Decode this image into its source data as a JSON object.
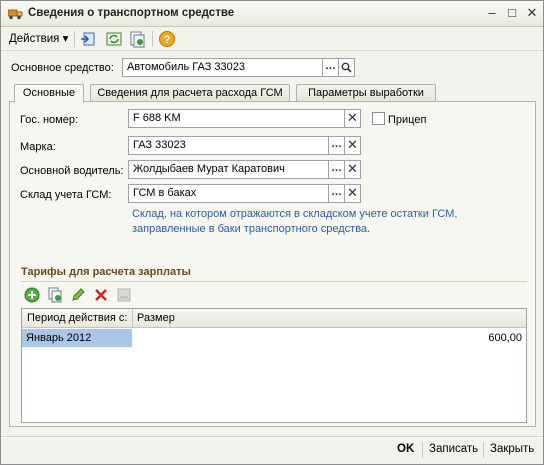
{
  "window": {
    "title": "Сведения о транспортном средстве"
  },
  "toolbar": {
    "actions_label": "Действия"
  },
  "main_asset": {
    "label": "Основное средство:",
    "value": "Автомобиль ГАЗ 33023"
  },
  "tabs": [
    {
      "label": "Основные"
    },
    {
      "label": "Сведения для расчета расхода ГСМ"
    },
    {
      "label": "Параметры выработки"
    }
  ],
  "fields": {
    "gos_nomer": {
      "label": "Гос. номер:",
      "value": "F 688 KM"
    },
    "marka": {
      "label": "Марка:",
      "value": "ГАЗ 33023"
    },
    "driver": {
      "label": "Основной водитель:",
      "value": "Жолдыбаев Мурат Каратович"
    },
    "warehouse": {
      "label": "Склад учета ГСМ:",
      "value": "ГСМ в баках"
    },
    "trailer": {
      "label": "Прицеп",
      "checked": false
    }
  },
  "hint": "Склад, на котором отражаются в складском учете остатки ГСМ, заправленные в баки транспортного средства.",
  "tariffs": {
    "title": "Тарифы для расчета зарплаты",
    "columns": [
      "Период действия с:",
      "Размер"
    ],
    "rows": [
      {
        "period": "Январь 2012",
        "size": "600,00"
      }
    ]
  },
  "footer": {
    "ok": "OK",
    "save": "Записать",
    "close": "Закрыть"
  }
}
